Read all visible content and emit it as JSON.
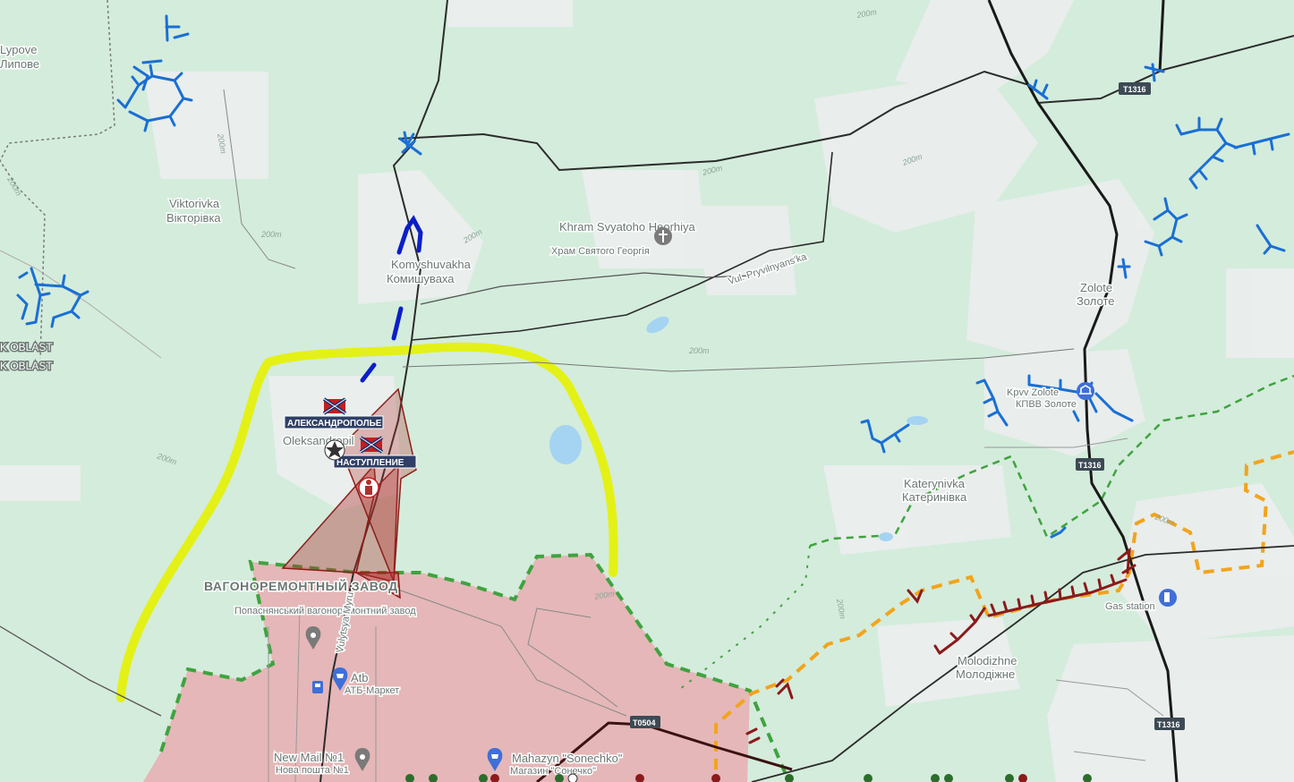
{
  "colors": {
    "background": "#d4ecdc",
    "urban": "#eceeee",
    "occupied_area": "#e7aeb1",
    "frontline_green": "#3fa33f",
    "frontline_orange": "#f2a41c",
    "yellow_arc": "#e6f200",
    "blue_positions": "#1a6fd4",
    "red_positions": "#9b1a1a",
    "road_major": "#2b2b2b",
    "attack_arrow": "#b0302c"
  },
  "places": [
    {
      "id": "lypove",
      "name": "Lypove",
      "name_local": "Липове"
    },
    {
      "id": "viktorivka",
      "name": "Viktorivka",
      "name_local": "Вікторівка"
    },
    {
      "id": "komyshuvakha",
      "name": "Komyshuvakha",
      "name_local": "Комишуваха"
    },
    {
      "id": "khram",
      "name": "Khram Svyatoho Heorhiya",
      "name_local": "Храм Святого Георгія"
    },
    {
      "id": "zolote",
      "name": "Zolote",
      "name_local": "Золоте"
    },
    {
      "id": "kpvv",
      "name": "Kpvv Zolote",
      "name_local": "КПВВ Золоте"
    },
    {
      "id": "katerynivka",
      "name": "Katerynivka",
      "name_local": "Катеринівка"
    },
    {
      "id": "molodizhne",
      "name": "Molodizhne",
      "name_local": "Молодіжне"
    },
    {
      "id": "gas",
      "name": "Gas station",
      "name_local": ""
    },
    {
      "id": "zavod",
      "name": "ВАГОНОРЕМОНТНЫЙ ЗАВОД",
      "name_local": "Попаснянський вагоноремонтний завод"
    },
    {
      "id": "atb",
      "name": "Atb",
      "name_local": "АТБ-Маркет"
    },
    {
      "id": "newmail",
      "name": "New Mail №1",
      "name_local": "Нова пошта №1"
    },
    {
      "id": "mahazyn",
      "name": "Mahazyn \"Sonechko\"",
      "name_local": "Магазин \"Сонечко\""
    }
  ],
  "labels": {
    "oleksandropil": "Oleksandropil",
    "street_vul": "Vul. Pryvilnyans'ka",
    "street_myru": "Vulytsya Myru",
    "oblast1": "K OBLAST",
    "oblast2": "K OBLAST"
  },
  "tags": {
    "aleksandropol": "АЛЕКСАНДРОПОЛЬЕ",
    "nastuplenie": "НАСТУПЛЕНИЕ"
  },
  "road_shields": [
    "T1316",
    "T1316",
    "T1316",
    "T0504"
  ],
  "contours": [
    "200m",
    "200m",
    "200m",
    "200m",
    "200m",
    "200m",
    "200m",
    "200m",
    "200m",
    "200m",
    "200m",
    "200m"
  ],
  "icons": [
    "star-marker-icon",
    "novorossiya-flag-icon",
    "soldier-icon",
    "place-pin-icon",
    "gas-station-icon",
    "shopping-cart-icon",
    "border-crossing-icon",
    "church-icon",
    "train-icon"
  ]
}
